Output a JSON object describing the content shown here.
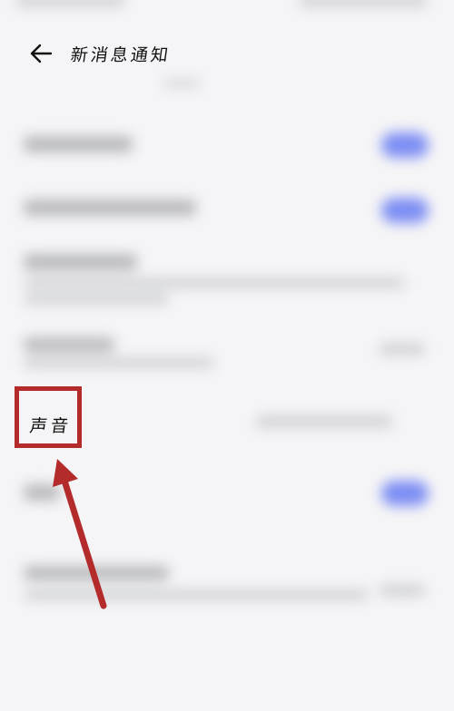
{
  "header": {
    "title": "新消息通知"
  },
  "sound_row": {
    "label": "声音"
  },
  "colors": {
    "accent_toggle": "#7d8ef3",
    "annotation_red": "#b32b2b",
    "background": "#f5f5f7"
  },
  "icons": {
    "back": "arrow-left-icon"
  }
}
